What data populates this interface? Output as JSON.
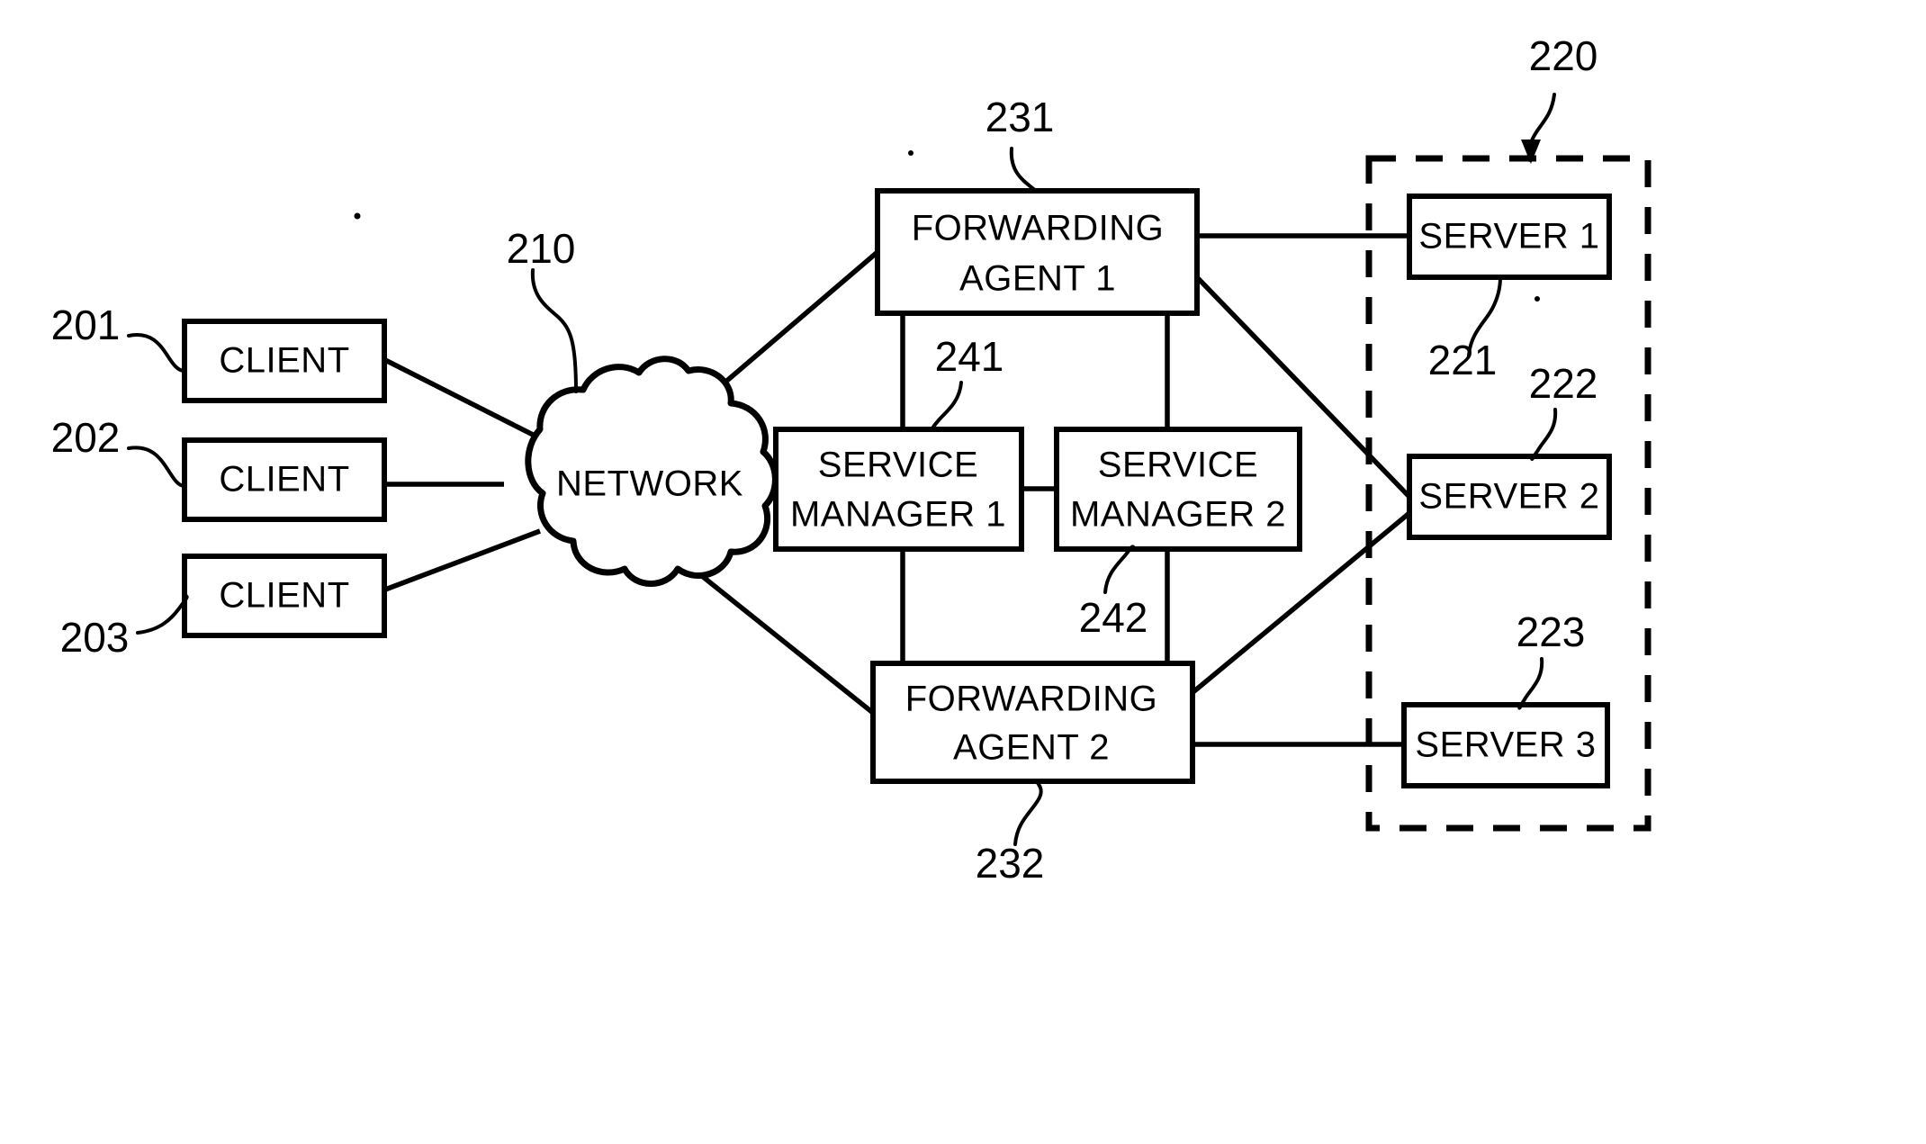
{
  "figure": {
    "title": "Client-server network with forwarding agents and service managers",
    "background_color": "#ffffff",
    "line_color": "#000000"
  },
  "nodes": {
    "client1": {
      "label": "CLIENT",
      "ref": "201"
    },
    "client2": {
      "label": "CLIENT",
      "ref": "202"
    },
    "client3": {
      "label": "CLIENT",
      "ref": "203"
    },
    "network": {
      "label": "NETWORK",
      "ref": "210"
    },
    "forwarding_agent_1": {
      "label_line1": "FORWARDING",
      "label_line2": "AGENT 1",
      "ref": "231"
    },
    "forwarding_agent_2": {
      "label_line1": "FORWARDING",
      "label_line2": "AGENT 2",
      "ref": "232"
    },
    "service_manager_1": {
      "label_line1": "SERVICE",
      "label_line2": "MANAGER 1",
      "ref": "241"
    },
    "service_manager_2": {
      "label_line1": "SERVICE",
      "label_line2": "MANAGER 2",
      "ref": "242"
    },
    "server1": {
      "label": "SERVER 1",
      "ref": "221"
    },
    "server2": {
      "label": "SERVER 2",
      "ref": "222"
    },
    "server3": {
      "label": "SERVER 3",
      "ref": "223"
    },
    "server_cluster": {
      "ref": "220"
    }
  },
  "ref_numbers": [
    "201",
    "202",
    "203",
    "210",
    "220",
    "221",
    "222",
    "223",
    "231",
    "232",
    "241",
    "242"
  ]
}
